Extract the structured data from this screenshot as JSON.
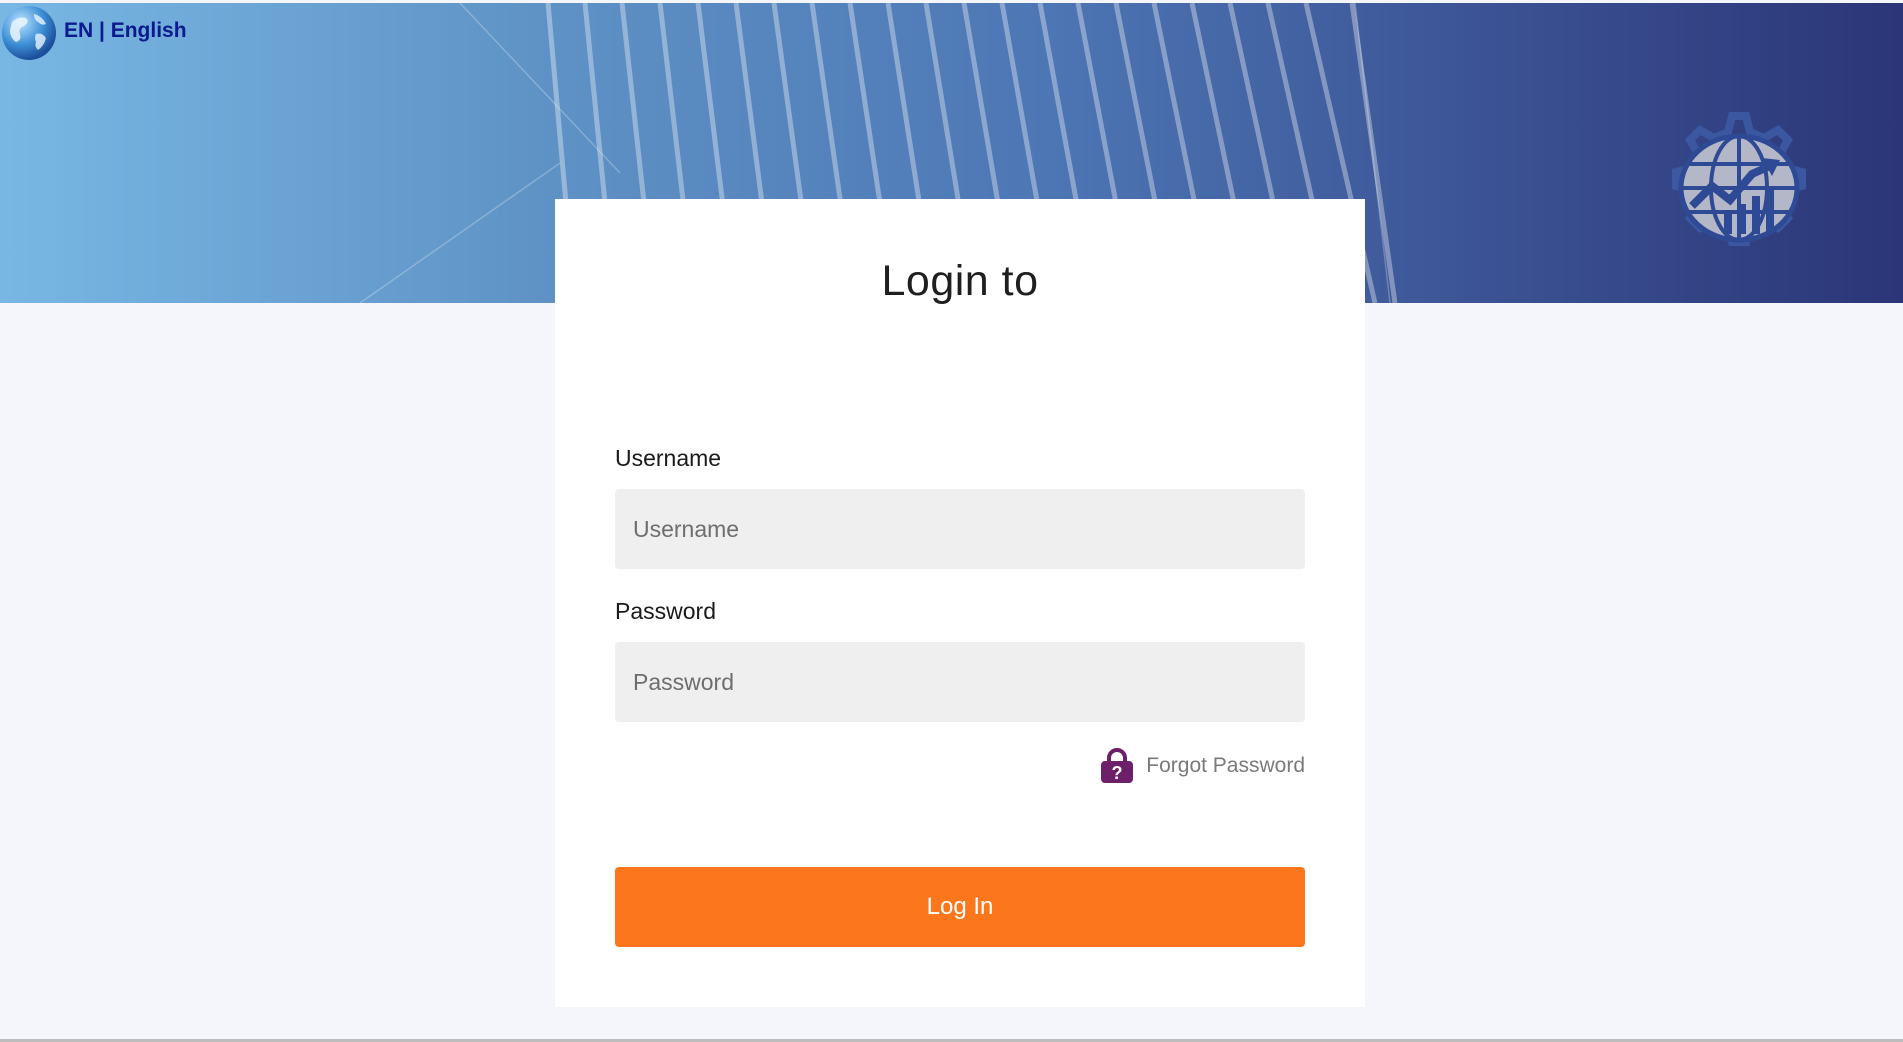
{
  "language": {
    "code": "EN",
    "separator": "|",
    "name": "English",
    "display": "EN | English",
    "icon": "globe-icon"
  },
  "header": {
    "emblem_icon": "globe-chart-gear-emblem-icon"
  },
  "login": {
    "title": "Login to",
    "username_label": "Username",
    "username_placeholder": "Username",
    "username_value": "",
    "password_label": "Password",
    "password_placeholder": "Password",
    "password_value": "",
    "forgot_password": "Forgot Password",
    "forgot_icon": "lock-question-icon",
    "submit_label": "Log In"
  },
  "colors": {
    "accent_button": "#fc761c",
    "language_text": "#0b1a8c",
    "forgot_icon": "#6d1f6a",
    "banner_start": "#78b7e4",
    "banner_end": "#2b3577",
    "page_background": "#f5f6fb"
  }
}
